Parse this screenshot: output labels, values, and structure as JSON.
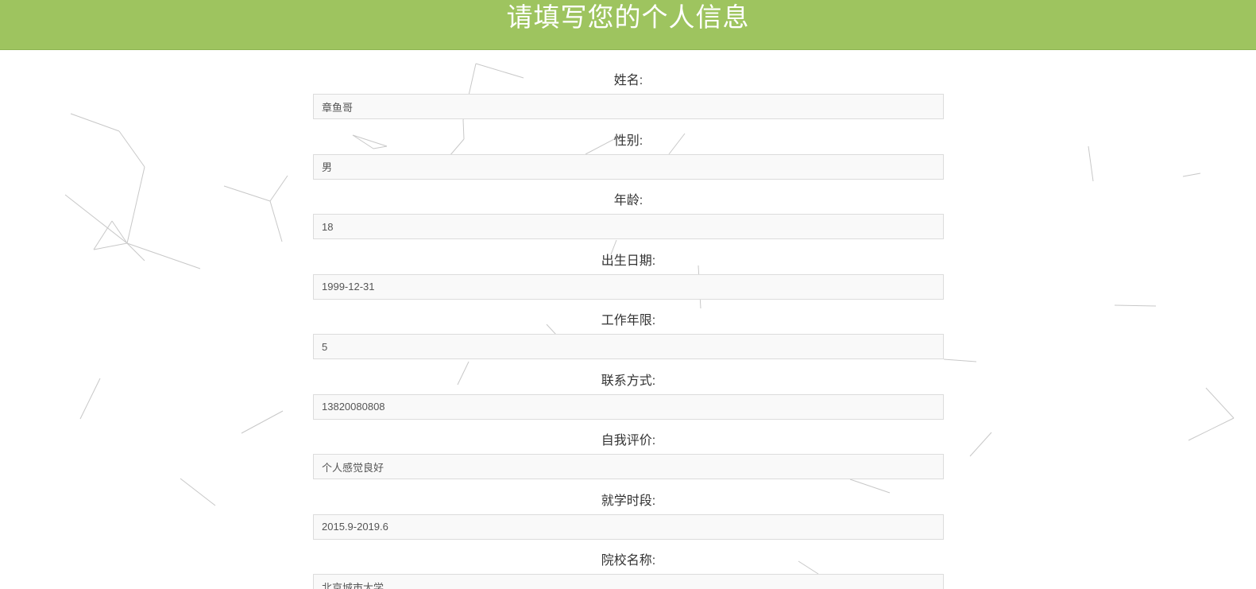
{
  "header": {
    "title": "请填写您的个人信息"
  },
  "form": {
    "fields": [
      {
        "label": "姓名:",
        "value": "章鱼哥"
      },
      {
        "label": "性别:",
        "value": "男"
      },
      {
        "label": "年龄:",
        "value": "18"
      },
      {
        "label": "出生日期:",
        "value": "1999-12-31"
      },
      {
        "label": "工作年限:",
        "value": "5"
      },
      {
        "label": "联系方式:",
        "value": "13820080808"
      },
      {
        "label": "自我评价:",
        "value": "个人感觉良好"
      },
      {
        "label": "就学时段:",
        "value": "2015.9-2019.6"
      },
      {
        "label": "院校名称:",
        "value": "北京城市大学"
      }
    ]
  },
  "colors": {
    "header_bg": "#9ec45f",
    "header_text": "#ffffff",
    "input_bg": "#f9f9f9",
    "input_border": "#dcdcdc"
  }
}
